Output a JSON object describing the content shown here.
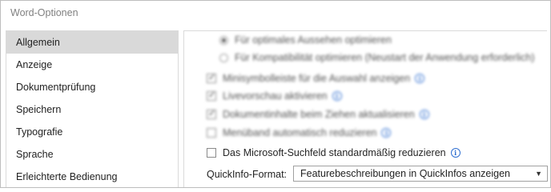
{
  "window": {
    "title": "Word-Optionen"
  },
  "sidebar": {
    "items": [
      {
        "label": "Allgemein",
        "selected": true
      },
      {
        "label": "Anzeige",
        "selected": false
      },
      {
        "label": "Dokumentprüfung",
        "selected": false
      },
      {
        "label": "Speichern",
        "selected": false
      },
      {
        "label": "Typografie",
        "selected": false
      },
      {
        "label": "Sprache",
        "selected": false
      },
      {
        "label": "Erleichterte Bedienung",
        "selected": false
      }
    ]
  },
  "content": {
    "radio_optimal": "Für optimales Aussehen optimieren",
    "radio_compat": "Für Kompatibilität optimieren (Neustart der Anwendung erforderlich)",
    "cb_minitoolbar": "Minisymbolleiste für die Auswahl anzeigen",
    "cb_livepreview": "Livevorschau aktivieren",
    "cb_drag_update": "Dokumentinhalte beim Ziehen aktualisieren",
    "cb_collapse_ribbon": "Menüband automatisch reduzieren",
    "cb_search_collapse": "Das Microsoft-Suchfeld standardmäßig reduzieren",
    "quickinfo_label": "QuickInfo-Format:",
    "quickinfo_value": "Featurebeschreibungen in QuickInfos anzeigen"
  },
  "icons": {
    "info": "info-icon",
    "dropdown": "chevron-down-icon"
  },
  "colors": {
    "selected_bg": "#d9d9d9",
    "info_blue": "#2f6fd1"
  }
}
